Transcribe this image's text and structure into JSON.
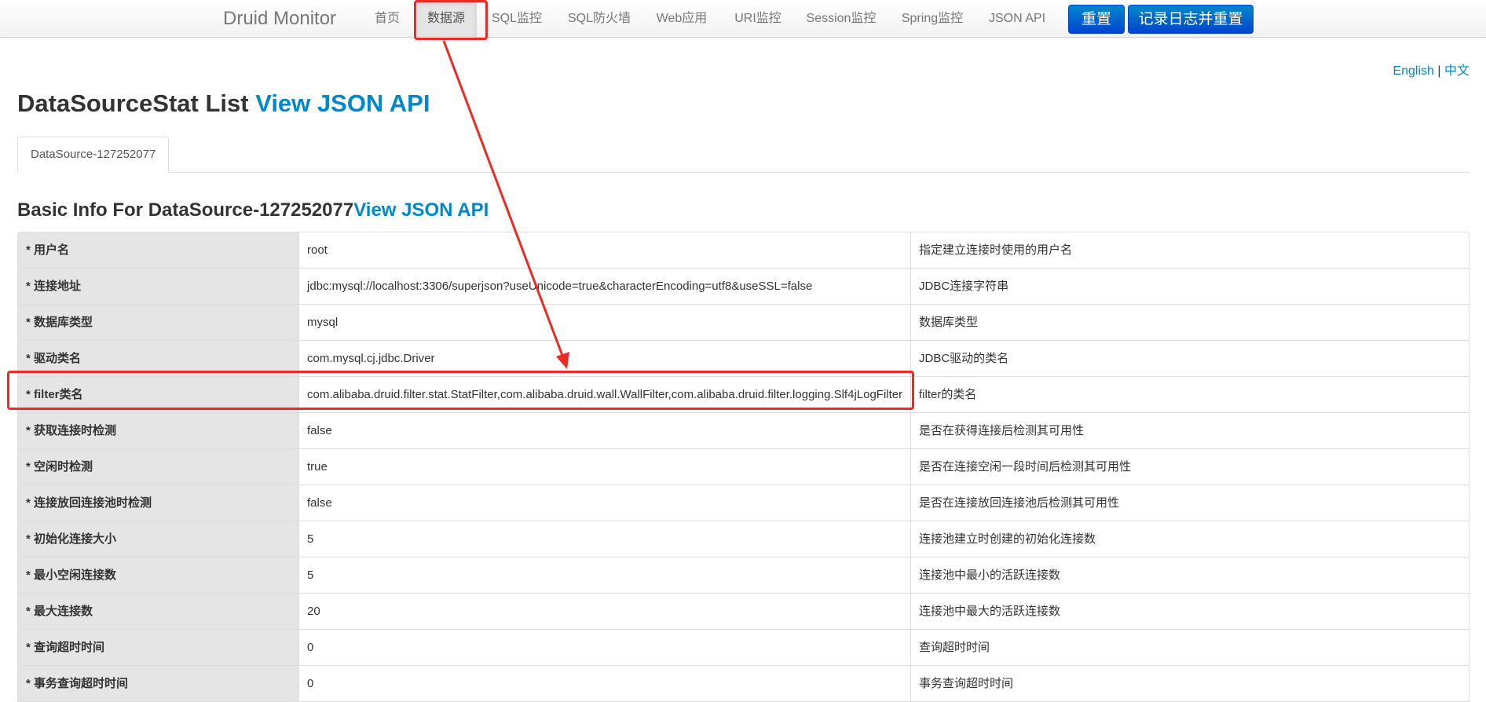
{
  "navbar": {
    "brand": "Druid Monitor",
    "items": [
      {
        "label": "首页",
        "active": false
      },
      {
        "label": "数据源",
        "active": true
      },
      {
        "label": "SQL监控",
        "active": false
      },
      {
        "label": "SQL防火墙",
        "active": false
      },
      {
        "label": "Web应用",
        "active": false
      },
      {
        "label": "URI监控",
        "active": false
      },
      {
        "label": "Session监控",
        "active": false
      },
      {
        "label": "Spring监控",
        "active": false
      },
      {
        "label": "JSON API",
        "active": false
      }
    ],
    "buttons": {
      "reset": "重置",
      "log_and_reset": "记录日志并重置"
    }
  },
  "lang": {
    "english": "English",
    "separator": "|",
    "chinese": "中文"
  },
  "header": {
    "title": "DataSourceStat List",
    "api_link": "View JSON API"
  },
  "tabs": [
    {
      "label": "DataSource-127252077",
      "active": true
    }
  ],
  "basic_info": {
    "title": "Basic Info For DataSource-127252077",
    "api_link": "View JSON API"
  },
  "table": {
    "rows": [
      {
        "label": "* 用户名",
        "value": "root",
        "desc": "指定建立连接时使用的用户名"
      },
      {
        "label": "* 连接地址",
        "value": "jdbc:mysql://localhost:3306/superjson?useUnicode=true&characterEncoding=utf8&useSSL=false",
        "desc": "JDBC连接字符串"
      },
      {
        "label": "* 数据库类型",
        "value": "mysql",
        "desc": "数据库类型"
      },
      {
        "label": "* 驱动类名",
        "value": "com.mysql.cj.jdbc.Driver",
        "desc": "JDBC驱动的类名"
      },
      {
        "label": "* filter类名",
        "value": "com.alibaba.druid.filter.stat.StatFilter,com.alibaba.druid.wall.WallFilter,com.alibaba.druid.filter.logging.Slf4jLogFilter",
        "desc": "filter的类名"
      },
      {
        "label": "* 获取连接时检测",
        "value": "false",
        "desc": "是否在获得连接后检测其可用性"
      },
      {
        "label": "* 空闲时检测",
        "value": "true",
        "desc": "是否在连接空闲一段时间后检测其可用性"
      },
      {
        "label": "* 连接放回连接池时检测",
        "value": "false",
        "desc": "是否在连接放回连接池后检测其可用性"
      },
      {
        "label": "* 初始化连接大小",
        "value": "5",
        "desc": "连接池建立时创建的初始化连接数"
      },
      {
        "label": "* 最小空闲连接数",
        "value": "5",
        "desc": "连接池中最小的活跃连接数"
      },
      {
        "label": "* 最大连接数",
        "value": "20",
        "desc": "连接池中最大的活跃连接数"
      },
      {
        "label": "* 查询超时时间",
        "value": "0",
        "desc": "查询超时时间"
      },
      {
        "label": "* 事务查询超时时间",
        "value": "0",
        "desc": "事务查询超时时间"
      }
    ]
  },
  "colors": {
    "accent": "#0088cc",
    "annotation": "#ee2a24",
    "label_bg": "#e5e5e5"
  }
}
